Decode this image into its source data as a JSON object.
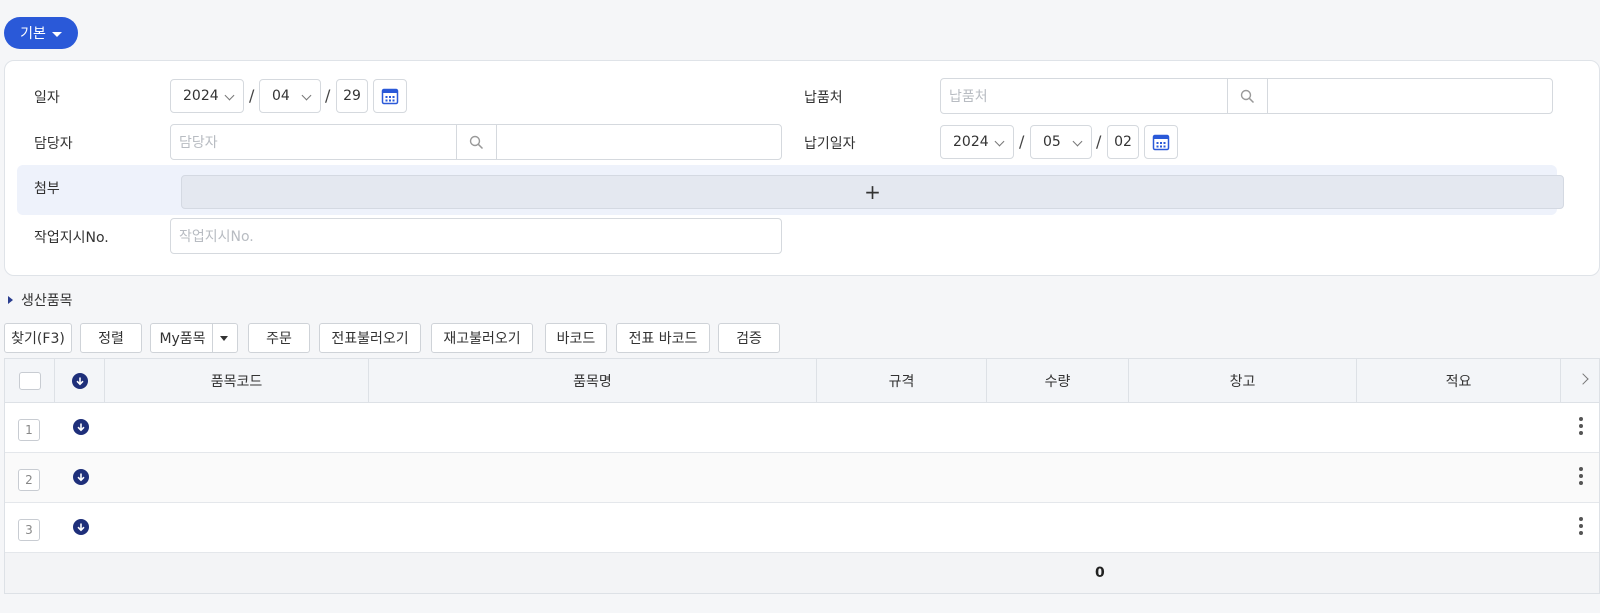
{
  "mode_button": {
    "label": "기본"
  },
  "form": {
    "date": {
      "label": "일자",
      "year": "2024",
      "month": "04",
      "day": "29",
      "separator": "/"
    },
    "supplier": {
      "label": "납품처",
      "placeholder": "납품처",
      "value": ""
    },
    "manager": {
      "label": "담당자",
      "placeholder": "담당자",
      "value": ""
    },
    "due_date": {
      "label": "납기일자",
      "year": "2024",
      "month": "05",
      "day": "02",
      "separator": "/"
    },
    "attachment": {
      "label": "첨부",
      "add_symbol": "+"
    },
    "work_order": {
      "label": "작업지시No.",
      "placeholder": "작업지시No."
    }
  },
  "section": {
    "title": "생산품목"
  },
  "toolbar": {
    "find": "찾기(F3)",
    "sort": "정렬",
    "my_items": "My품목",
    "order": "주문",
    "load_slip": "전표불러오기",
    "load_stock": "재고불러오기",
    "barcode": "바코드",
    "slip_barcode": "전표 바코드",
    "verify": "검증"
  },
  "grid": {
    "columns": [
      "품목코드",
      "품목명",
      "규격",
      "수량",
      "창고",
      "적요"
    ],
    "rows": [
      {
        "num": "1"
      },
      {
        "num": "2"
      },
      {
        "num": "3"
      }
    ],
    "footer_total": "0"
  }
}
